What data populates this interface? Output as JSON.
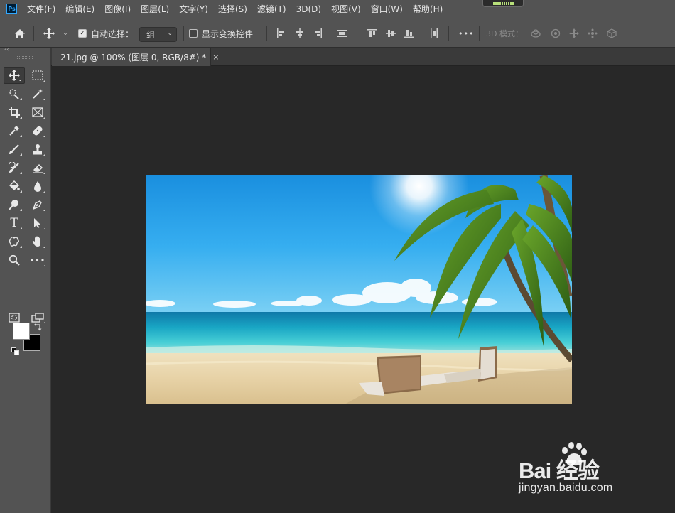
{
  "app": {
    "logo_text": "Ps"
  },
  "menubar": {
    "items": [
      "文件(F)",
      "编辑(E)",
      "图像(I)",
      "图层(L)",
      "文字(Y)",
      "选择(S)",
      "滤镜(T)",
      "3D(D)",
      "视图(V)",
      "窗口(W)",
      "帮助(H)"
    ]
  },
  "options": {
    "auto_select_label": "自动选择：",
    "auto_select_checked": true,
    "auto_select_value": "组",
    "show_transform_label": "显示变换控件",
    "show_transform_checked": false,
    "mode_3d_label": "3D 模式：",
    "more_glyph": "•••"
  },
  "tabs": [
    {
      "title": "21.jpg @ 100% (图层 0, RGB/8#) *",
      "close": "×"
    }
  ],
  "colors": {
    "foreground": "#ffffff",
    "background": "#000000",
    "accent": "#31a8ff"
  },
  "watermark": {
    "line1": "Bai 经验",
    "line2": "jingyan.baidu.com"
  },
  "tools": [
    "move-tool",
    "rectangular-marquee-tool",
    "quick-selection-tool",
    "magic-wand-tool",
    "crop-tool",
    "frame-tool",
    "eyedropper-tool",
    "spot-healing-brush-tool",
    "brush-tool",
    "clone-stamp-tool",
    "history-brush-tool",
    "eraser-tool",
    "paint-bucket-tool",
    "blur-tool",
    "dodge-tool",
    "pen-tool",
    "type-tool",
    "path-selection-tool",
    "custom-shape-tool",
    "hand-tool",
    "zoom-tool",
    "edit-toolbar"
  ]
}
